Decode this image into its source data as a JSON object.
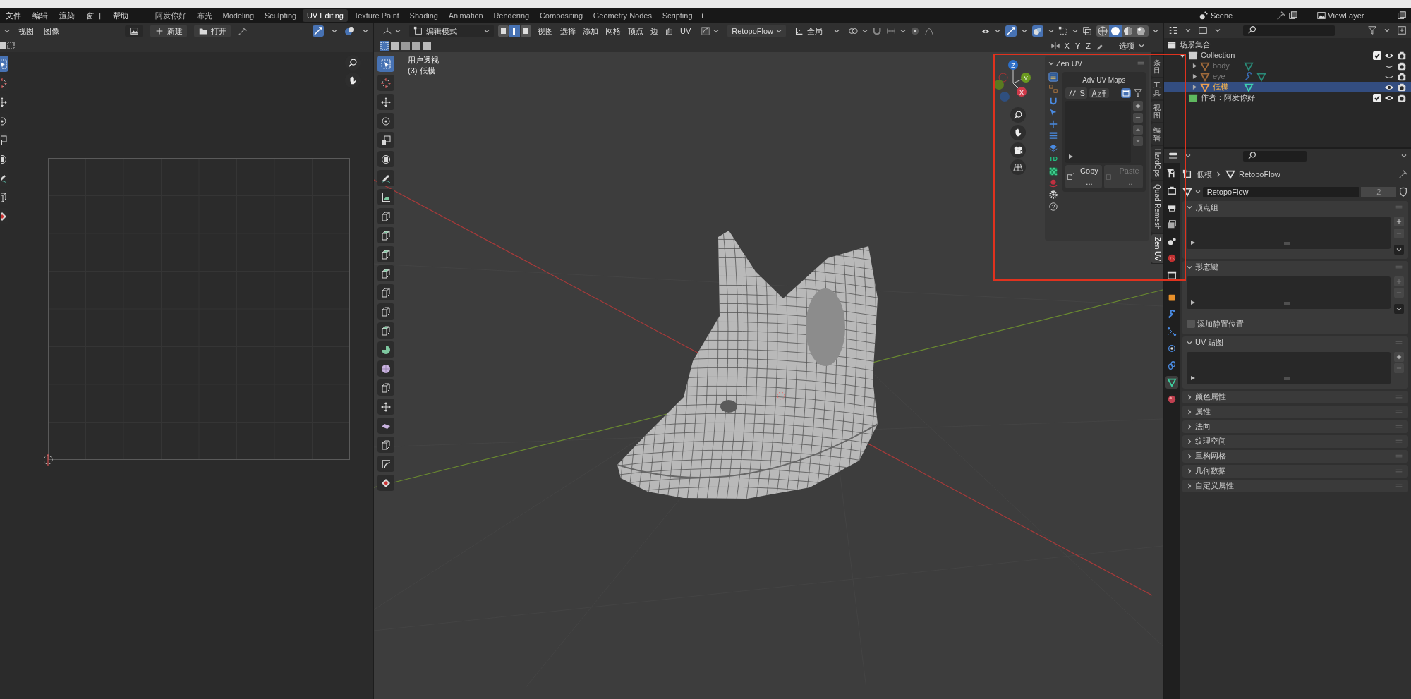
{
  "menus": [
    "文件",
    "编辑",
    "渲染",
    "窗口",
    "帮助"
  ],
  "workspaces": [
    {
      "label": "阿发你好",
      "selected": false
    },
    {
      "label": "布光",
      "selected": false
    },
    {
      "label": "Modeling",
      "selected": false
    },
    {
      "label": "Sculpting",
      "selected": false
    },
    {
      "label": "UV Editing",
      "selected": true
    },
    {
      "label": "Texture Paint",
      "selected": false
    },
    {
      "label": "Shading",
      "selected": false
    },
    {
      "label": "Animation",
      "selected": false
    },
    {
      "label": "Rendering",
      "selected": false
    },
    {
      "label": "Compositing",
      "selected": false
    },
    {
      "label": "Geometry Nodes",
      "selected": false
    },
    {
      "label": "Scripting",
      "selected": false
    }
  ],
  "add_workspace": "+",
  "scene": "Scene",
  "view_layer": "ViewLayer",
  "uv_editor": {
    "menus": [
      "视图",
      "图像"
    ],
    "new_button": "新建",
    "open_button": "打开",
    "tools": [
      {
        "kind": "select",
        "selected": true
      },
      {
        "kind": "crosshair",
        "selected": false
      },
      {
        "kind": "move",
        "selected": false
      },
      {
        "kind": "rotate",
        "selected": false
      },
      {
        "kind": "scale",
        "selected": false
      },
      {
        "kind": "transform",
        "selected": false
      },
      {
        "kind": "pencil",
        "selected": false
      },
      {
        "kind": "cube",
        "selected": false
      },
      {
        "kind": "checker",
        "selected": false
      }
    ]
  },
  "viewport": {
    "mode": "编辑模式",
    "menus": [
      "视图",
      "选择",
      "添加",
      "网格",
      "顶点",
      "边",
      "面",
      "UV"
    ],
    "addon_menu": "RetopoFlow",
    "orientation": "全局",
    "mirror_axes": [
      "X",
      "Y",
      "Z"
    ],
    "options_label": "选项",
    "info_lines": [
      "用户透视",
      "(3) 低模"
    ],
    "gizmo": {
      "x": "X",
      "y": "Y",
      "z": "Z"
    },
    "tools": [
      {
        "kind": "select",
        "selected": true
      },
      {
        "kind": "crosshair",
        "selected": false
      },
      {
        "kind": "move",
        "selected": false
      },
      {
        "kind": "rotate",
        "selected": false
      },
      {
        "kind": "scale",
        "selected": false
      },
      {
        "kind": "transform",
        "selected": false
      },
      {
        "kind": "pencil",
        "selected": false
      },
      {
        "kind": "ruler",
        "selected": false
      },
      {
        "kind": "cube",
        "selected": false
      },
      {
        "kind": "green-cube",
        "selected": false
      },
      {
        "kind": "green-cube",
        "selected": false
      },
      {
        "kind": "green-cube",
        "selected": false
      },
      {
        "kind": "cube",
        "selected": false
      },
      {
        "kind": "cube",
        "selected": false
      },
      {
        "kind": "green-cube",
        "selected": false
      },
      {
        "kind": "spin",
        "selected": false
      },
      {
        "kind": "sphere",
        "selected": false
      },
      {
        "kind": "cube",
        "selected": false
      },
      {
        "kind": "move",
        "selected": false
      },
      {
        "kind": "slab",
        "selected": false
      },
      {
        "kind": "cube",
        "selected": false
      },
      {
        "kind": "corner",
        "selected": false
      },
      {
        "kind": "checker",
        "selected": false
      }
    ]
  },
  "zen_uv": {
    "title": "Zen UV",
    "panel_title": "Adv UV Maps",
    "sync_button": "S",
    "copy_button": "Copy ...",
    "paste_button": "Paste ...",
    "td_label": "TD"
  },
  "sidebar_tabs": [
    {
      "label": "条目",
      "kind": "stacked",
      "selected": false
    },
    {
      "label": "工具",
      "kind": "stacked",
      "selected": false
    },
    {
      "label": "视图",
      "kind": "stacked",
      "selected": false
    },
    {
      "label": "编辑",
      "kind": "stacked",
      "selected": false
    },
    {
      "label": "HardOps",
      "kind": "rotated",
      "selected": false
    },
    {
      "label": "Quad Remesh",
      "kind": "rotated",
      "selected": false
    },
    {
      "label": "Zen UV",
      "kind": "rotated",
      "selected": true
    }
  ],
  "outliner": {
    "title": "场景集合",
    "items": [
      {
        "name": "Collection",
        "kind": "collection",
        "color": "#d0d0d0",
        "expanded": true,
        "checked": true,
        "visible": true,
        "children": [
          {
            "name": "body",
            "kind": "mesh",
            "selected": false,
            "visible": false,
            "modifier": false
          },
          {
            "name": "eye",
            "kind": "mesh",
            "selected": false,
            "visible": false,
            "modifier": true
          },
          {
            "name": "低模",
            "kind": "mesh",
            "selected": true,
            "visible": true,
            "modifier": false
          }
        ]
      },
      {
        "name": "作者：阿发你好",
        "kind": "collection",
        "color": "#5fb85f",
        "checked": true,
        "visible": true
      }
    ]
  },
  "properties": {
    "tabs": [
      {
        "kind": "tool",
        "selected": false
      },
      {
        "kind": "render",
        "selected": false
      },
      {
        "kind": "output",
        "selected": false
      },
      {
        "kind": "view-layer",
        "selected": false
      },
      {
        "kind": "scene",
        "selected": false
      },
      {
        "kind": "world",
        "selected": false
      },
      {
        "kind": "collection",
        "selected": false
      },
      {
        "kind": "object",
        "selected": false
      },
      {
        "kind": "modifier",
        "selected": false
      },
      {
        "kind": "particles",
        "selected": false
      },
      {
        "kind": "physics",
        "selected": false
      },
      {
        "kind": "constraints",
        "selected": false
      },
      {
        "kind": "data",
        "selected": true
      },
      {
        "kind": "material",
        "selected": false
      }
    ],
    "object_name": "低模",
    "mesh_name": "RetopoFlow",
    "mesh_field": "RetopoFlow",
    "users": "2",
    "panels": [
      {
        "title": "顶点组",
        "expanded": true,
        "menu_button": true
      },
      {
        "title": "形态键",
        "expanded": true,
        "menu_button": true,
        "checkbox": {
          "label": "添加静置位置",
          "checked": false
        }
      },
      {
        "title": "UV 贴图",
        "expanded": true,
        "menu_button": false
      },
      {
        "title": "颜色属性",
        "expanded": false
      },
      {
        "title": "属性",
        "expanded": false
      },
      {
        "title": "法向",
        "expanded": false
      },
      {
        "title": "纹理空间",
        "expanded": false
      },
      {
        "title": "重构网格",
        "expanded": false
      },
      {
        "title": "几何数据",
        "expanded": false
      },
      {
        "title": "自定义属性",
        "expanded": false
      }
    ]
  }
}
